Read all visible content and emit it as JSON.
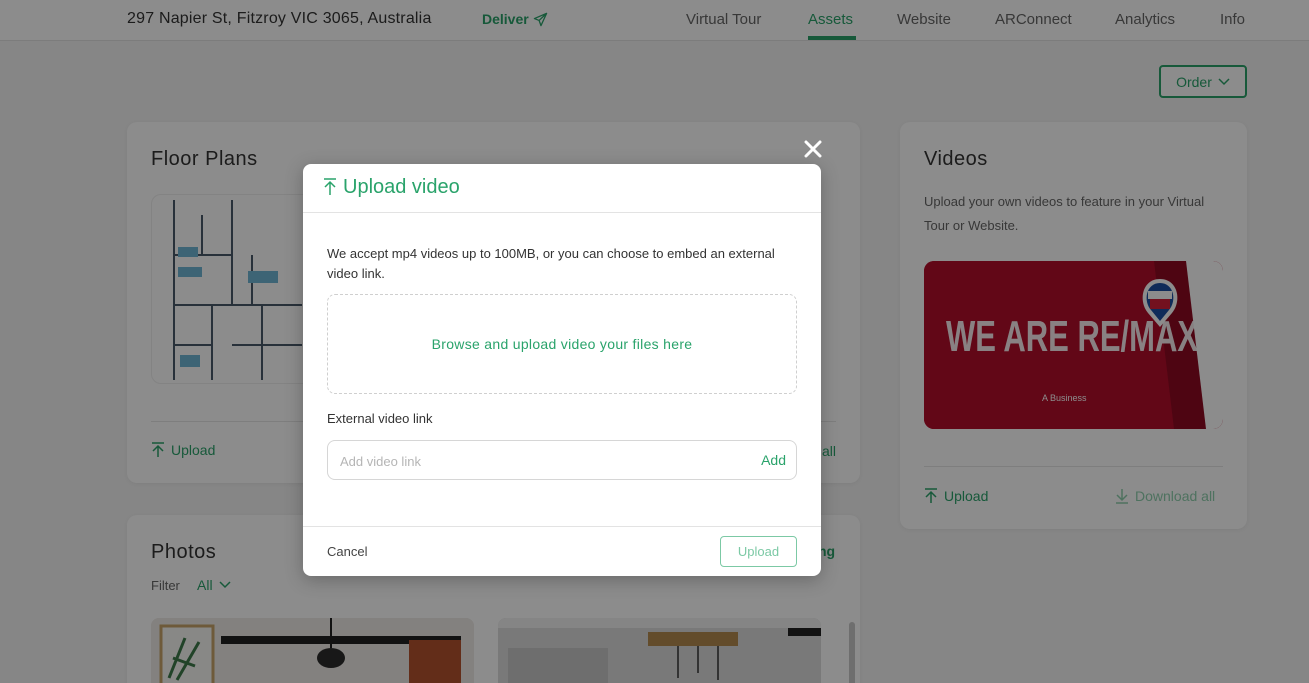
{
  "header": {
    "address": "297 Napier St, Fitzroy VIC 3065, Australia",
    "deliver_label": "Deliver",
    "nav": [
      "Virtual Tour",
      "Assets",
      "Website",
      "ARConnect",
      "Analytics",
      "Info"
    ],
    "active_tab": "Assets"
  },
  "order_button": "Order",
  "floor_plans": {
    "title": "Floor Plans",
    "upload_label": "Upload",
    "download_partial": "all"
  },
  "videos": {
    "title": "Videos",
    "description": "Upload your own videos to feature in your Virtual Tour or Website.",
    "image_logo_text": "WE ARE RE/MAX",
    "image_caption": "A Business",
    "upload_label": "Upload",
    "download_label": "Download all"
  },
  "photos": {
    "title": "Photos",
    "filter_label": "Filter",
    "filter_value": "All",
    "right_partial": "ng"
  },
  "modal": {
    "title": "Upload video",
    "description": "We accept mp4 videos up to 100MB, or you can choose to embed an external video link.",
    "dropzone_text": "Browse and upload video your files here",
    "external_label": "External video link",
    "link_placeholder": "Add video link",
    "add_label": "Add",
    "cancel_label": "Cancel",
    "upload_label": "Upload"
  },
  "colors": {
    "accent": "#2aa36b",
    "accent_disabled": "#7cc9a5",
    "remax_red": "#b30d2b"
  }
}
